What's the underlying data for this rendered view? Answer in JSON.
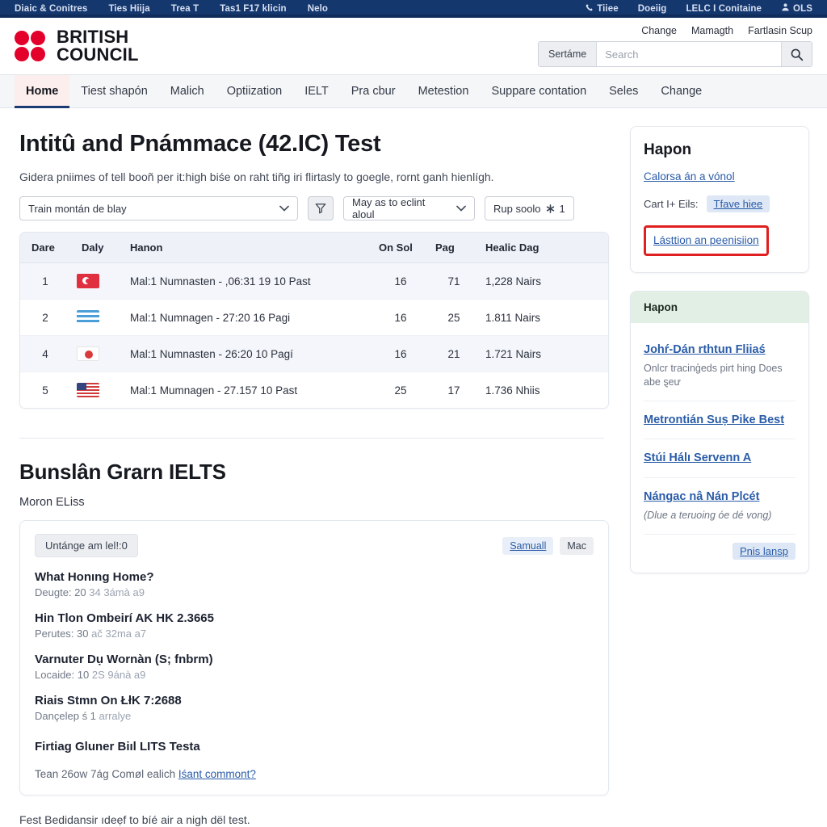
{
  "topbar": {
    "left_items": [
      "Diaic & Conitres",
      "Ties Hiija",
      "Trea T",
      "Tas1 F17 klicin",
      "Nelo"
    ],
    "right_items": [
      {
        "label": "Tiiee",
        "icon": "phone-icon"
      },
      {
        "label": "Doeiig",
        "icon": ""
      },
      {
        "label": "LELC I Conitaine",
        "icon": ""
      },
      {
        "label": "OLS",
        "icon": "user-icon"
      }
    ]
  },
  "masthead": {
    "brand_line1": "BRITISH",
    "brand_line2": "COUNCIL",
    "utility_links": [
      "Change",
      "Mamagth",
      "Fartlasin Scup"
    ],
    "search": {
      "scope_label": "Sertáme",
      "placeholder": "Search",
      "value": "",
      "button_icon": "search-icon"
    }
  },
  "nav": {
    "items": [
      {
        "label": "Home",
        "active": true
      },
      {
        "label": "Tiest shapón",
        "active": false
      },
      {
        "label": "Malich",
        "active": false
      },
      {
        "label": "Optiization",
        "active": false
      },
      {
        "label": "IELT",
        "active": false
      },
      {
        "label": "Pra cbur",
        "active": false
      },
      {
        "label": "Metestion",
        "active": false
      },
      {
        "label": "Suppare contation",
        "active": false
      },
      {
        "label": "Seles",
        "active": false
      },
      {
        "label": "Change",
        "active": false
      }
    ]
  },
  "main": {
    "title": "Intitû and Pnámmace (42.IC) Test",
    "lede": "Gidera pniimes of tell booñ per it:high biśe on raht tiñg iri flirtasly to goegle, rornt ganh hienlígh.",
    "filters": {
      "select_primary": "Train montán de blay",
      "filter_icon": "funnel-icon",
      "select_secondary": "May as to eclint aloul",
      "pill_label": "Rup soolo",
      "pill_icon": "asterisk-icon",
      "pill_count": "1"
    },
    "table": {
      "columns": [
        "Dare",
        "Daly",
        "Hanon",
        "On Sol",
        "Pag",
        "Healic Dag"
      ],
      "rows": [
        {
          "rank": "1",
          "flag": "tr",
          "name": "Mal:1 Numnasten - ,06:31 19 10 Past",
          "n1": "16",
          "n2": "71",
          "last": "1,228 Nairs"
        },
        {
          "rank": "2",
          "flag": "gr",
          "name": "Mal:1 Numnagen - 27:20 16 Pagi",
          "n1": "16",
          "n2": "25",
          "last": "1.811 Nairs"
        },
        {
          "rank": "4",
          "flag": "jp",
          "name": "Mal:1 Numnasten - 26:20 10 Pagí",
          "n1": "16",
          "n2": "21",
          "last": "1.721 Nairs"
        },
        {
          "rank": "5",
          "flag": "us",
          "name": "Mal:1 Mumnagen - 27.157 10 Past",
          "n1": "25",
          "n2": "17",
          "last": "1.736 Nhiis"
        }
      ]
    },
    "section": {
      "title": "Bunslân Grarn IELTS",
      "subtitle": "Moron ELiss",
      "panel": {
        "tag": "Untánge am lel!:0",
        "action_primary": "Samuall",
        "action_secondary": "Mac",
        "entries": [
          {
            "title": "What Honıng Home?",
            "meta_label": "Deugte:",
            "meta_value": "20",
            "meta_extra": "34 3ámà a9"
          },
          {
            "title": "Hin Tlon Ombeirí AK HK 2.3665",
            "meta_label": "Perutes:",
            "meta_value": "30",
            "meta_extra": "ač 32ma a7"
          },
          {
            "title": "Varnuter Dụ Wornàn (S; fnbrm)",
            "meta_label": "Locaide:",
            "meta_value": "10",
            "meta_extra": "2S 9ánà a9"
          },
          {
            "title": "Riais Stmn On ŁłK 7:2688",
            "meta_label": "Dançelep",
            "meta_value": "ś 1",
            "meta_extra": "arralye"
          }
        ],
        "footer_title": "Firtiag Gluner Biıl LITS Testa",
        "footer_question": "Tean 26ow 7ág Comøl ealich ",
        "footer_link": "Iśant commont?"
      }
    },
    "tail": "Fest Bedidansir ıdeẹf to bíé air a nigh dël test."
  },
  "sidebar": {
    "card_account": {
      "title": "Hapon",
      "link": "Calorsa án a vónol",
      "cart_label": "Cart I+ Eils:",
      "cart_chip": "Tfave hiee",
      "highlight_link": "Lásttion an peenisiion"
    },
    "card_news": {
      "header": "Hapon",
      "items": [
        {
          "heading": "Johŕ-Dán rthtun Fliiaś",
          "body": "Onlcr tracinģeds pirt hing Does abe ȿeư",
          "italic": false
        },
        {
          "heading": "Metrontián Suṣ Pike Best",
          "body": "",
          "italic": false
        },
        {
          "heading": "Stúi Hálı Servenn A",
          "body": "",
          "italic": false
        },
        {
          "heading": "Nángac nâ Nán Plcét",
          "body": "(Dlue a teruoing óe dé vong)",
          "italic": true
        }
      ],
      "footer_link": "Pnis lansp"
    }
  },
  "colors": {
    "topbar_blue": "#14376e",
    "brand_red": "#e3002b",
    "accent_link": "#2a5ca8",
    "highlight_red": "#e02020",
    "nav_active_bg": "#fdeeee",
    "nav_active_underline": "#1b3a73",
    "green_header": "#e2efe4"
  }
}
